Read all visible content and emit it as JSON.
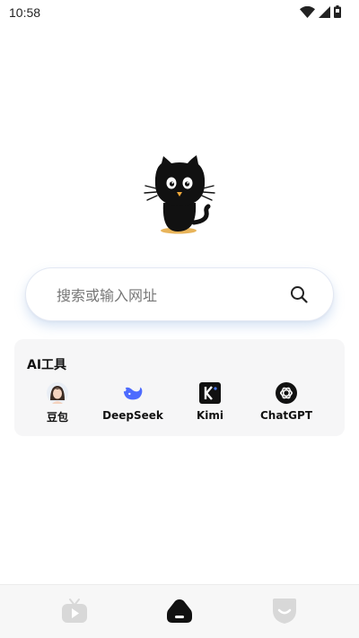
{
  "status_bar": {
    "time": "10:58",
    "icons": [
      "wifi-icon",
      "signal-icon",
      "battery-icon"
    ]
  },
  "logo": {
    "icon": "black-cat-logo"
  },
  "search": {
    "placeholder": "搜索或输入网址",
    "icon": "search-icon"
  },
  "ai_tools": {
    "title": "AI工具",
    "items": [
      {
        "label": "豆包",
        "icon": "doubao-avatar-icon"
      },
      {
        "label": "DeepSeek",
        "icon": "deepseek-whale-icon"
      },
      {
        "label": "Kimi",
        "icon": "kimi-icon"
      },
      {
        "label": "ChatGPT",
        "icon": "chatgpt-icon"
      }
    ]
  },
  "bottom_nav": {
    "items": [
      {
        "icon": "tv-icon",
        "active": false
      },
      {
        "icon": "home-icon",
        "active": true
      },
      {
        "icon": "shield-icon",
        "active": false
      }
    ]
  },
  "colors": {
    "accent_blue": "#3b6cf6",
    "search_glow": "#a9c7f0",
    "nav_active": "#111111",
    "nav_inactive": "#d6d6d6"
  }
}
